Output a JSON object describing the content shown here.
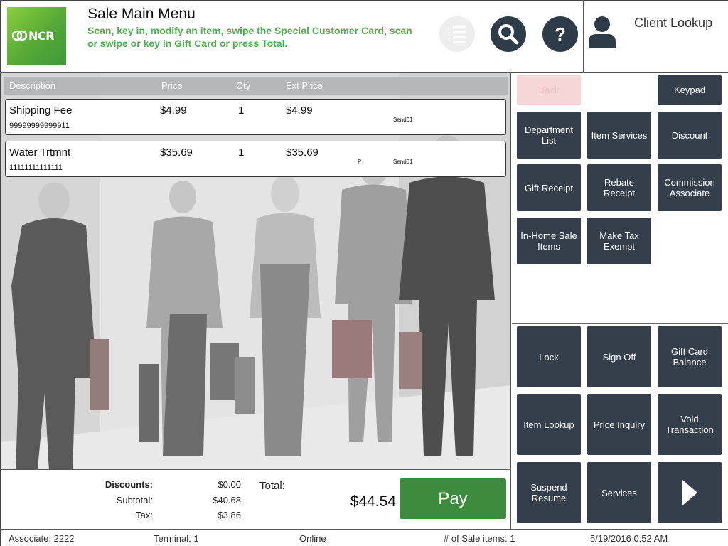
{
  "header": {
    "logo_text": "NCR",
    "title": "Sale Main Menu",
    "subtitle": "Scan, key in, modify an item, swipe the Special Customer Card, scan or swipe or key in Gift Card or press Total.",
    "help_glyph": "?",
    "client_lookup_label": "Client Lookup",
    "icons": [
      "list-icon",
      "search-icon",
      "help-icon",
      "user-icon"
    ]
  },
  "table": {
    "columns": {
      "description": "Description",
      "price": "Price",
      "qty": "Qty",
      "ext_price": "Ext Price"
    },
    "rows": [
      {
        "description": "Shipping Fee",
        "sku": "99999999999911",
        "price": "$4.99",
        "qty": "1",
        "ext_price": "$4.99",
        "flag": "",
        "send": "Send01"
      },
      {
        "description": "Water Trtmnt",
        "sku": "11111111111111",
        "price": "$35.69",
        "qty": "1",
        "ext_price": "$35.69",
        "flag": "P",
        "send": "Send01"
      }
    ]
  },
  "totals": {
    "discounts_label": "Discounts:",
    "discounts": "$0.00",
    "subtotal_label": "Subtotal:",
    "subtotal": "$40.68",
    "tax_label": "Tax:",
    "tax": "$3.86",
    "total_label": "Total:",
    "total": "$44.54",
    "pay_label": "Pay"
  },
  "buttons": {
    "back": "Back",
    "keypad": "Keypad",
    "department_list": "Department List",
    "item_services": "Item Services",
    "discount": "Discount",
    "gift_receipt": "Gift Receipt",
    "rebate_receipt": "Rebate Receipt",
    "commission_associate": "Commission Associate",
    "in_home_sale_items": "In-Home Sale Items",
    "make_tax_exempt": "Make Tax Exempt",
    "lock": "Lock",
    "sign_off": "Sign Off",
    "gift_card_balance": "Gift Card Balance",
    "item_lookup": "Item Lookup",
    "price_inquiry": "Price Inquiry",
    "void_transaction": "Void Transaction",
    "suspend_resume": "Suspend Resume",
    "services": "Services",
    "next_icon": "play-arrow-icon"
  },
  "status": {
    "associate": "Associate: 2222",
    "terminal": "Terminal: 1",
    "connection": "Online",
    "sale_items": "# of Sale items: 1",
    "datetime": "5/19/2016 0:52 AM"
  },
  "colors": {
    "brand_green": "#56a836",
    "button_dark": "#353e4b",
    "pay_green": "#3d8b3d",
    "subtitle_green": "#4caf50",
    "back_disabled": "#f6d6d6"
  }
}
